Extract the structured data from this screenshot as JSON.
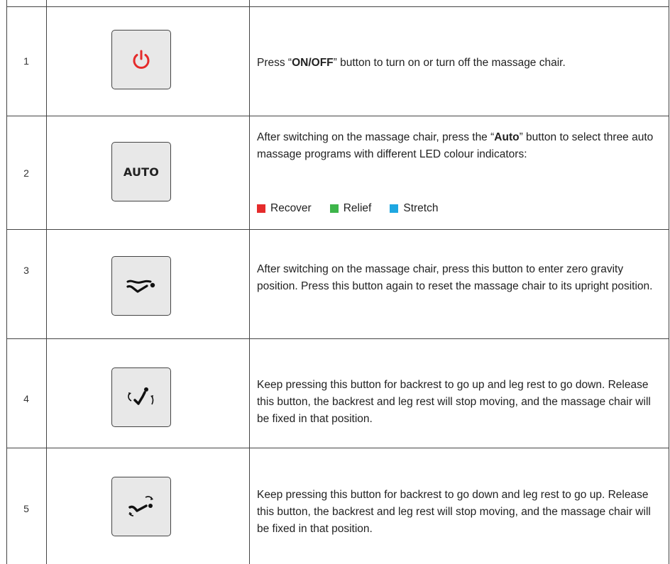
{
  "rows": [
    {
      "number": "1",
      "icon": "power-icon",
      "description_pre": "Press “",
      "description_bold": "ON/OFF",
      "description_post": "” button to turn on or turn off the massage chair."
    },
    {
      "number": "2",
      "button_label": "AUTO",
      "description_pre": "After switching on the massage chair, press the “",
      "description_bold": "Auto",
      "description_post": "” button to select three auto massage programs with different LED colour indicators:",
      "legend": [
        {
          "label": "Recover",
          "color": "#e52b2b"
        },
        {
          "label": "Relief",
          "color": "#3db54a"
        },
        {
          "label": "Stretch",
          "color": "#1ea7e1"
        }
      ]
    },
    {
      "number": "3",
      "icon": "zero-gravity-icon",
      "description": "After switching on the massage chair, press this button to enter zero gravity position. Press this button again to reset the massage chair to its upright position."
    },
    {
      "number": "4",
      "icon": "backrest-up-icon",
      "description": "Keep pressing this button for backrest to go up and leg rest to go down. Release this button, the backrest and leg rest will stop moving, and the massage chair will be fixed in that position."
    },
    {
      "number": "5",
      "icon": "backrest-down-icon",
      "description": "Keep pressing this button for backrest to go down and leg rest to go up. Release this button, the backrest and leg rest will stop moving, and the massage chair will be fixed in that position."
    }
  ],
  "colors": {
    "power_red": "#e52b2b",
    "border": "#444444",
    "button_bg": "#e8e8e8"
  }
}
